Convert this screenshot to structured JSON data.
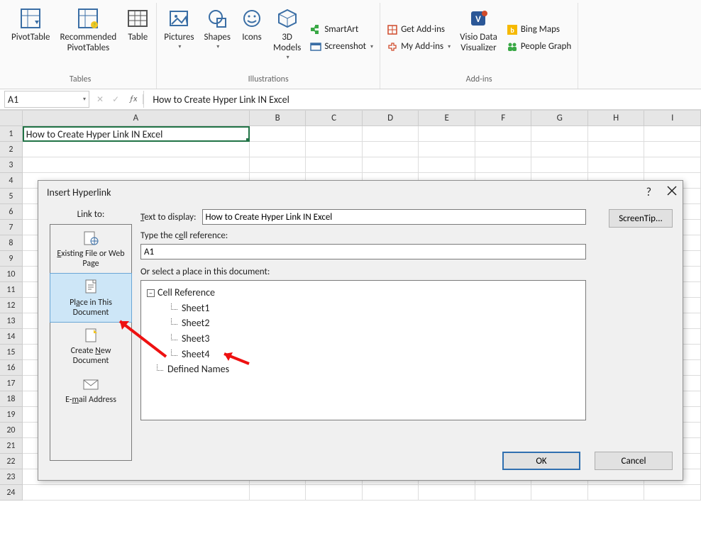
{
  "ribbon": {
    "groups": {
      "tables": {
        "label": "Tables",
        "pivottable": "PivotTable",
        "recommended": "Recommended\nPivotTables",
        "table": "Table"
      },
      "illustrations": {
        "label": "Illustrations",
        "pictures": "Pictures",
        "shapes": "Shapes",
        "icons": "Icons",
        "models": "3D\nModels",
        "smartart": "SmartArt",
        "screenshot": "Screenshot"
      },
      "addins": {
        "label": "Add-ins",
        "get": "Get Add-ins",
        "my": "My Add-ins",
        "visio": "Visio Data\nVisualizer",
        "bing": "Bing Maps",
        "people": "People Graph"
      }
    }
  },
  "formula_bar": {
    "name_box": "A1",
    "text": "How to Create Hyper Link IN Excel"
  },
  "grid": {
    "columns": [
      "A",
      "B",
      "C",
      "D",
      "E",
      "F",
      "G",
      "H",
      "I"
    ],
    "rows": [
      "1",
      "2",
      "3",
      "4",
      "5",
      "6",
      "7",
      "8",
      "9",
      "10",
      "11",
      "12",
      "13",
      "14",
      "15",
      "16",
      "17",
      "18",
      "19",
      "20",
      "21",
      "22",
      "23",
      "24"
    ],
    "a1": "How to Create Hyper Link IN Excel"
  },
  "dialog": {
    "title": "Insert Hyperlink",
    "help_icon": "?",
    "linkto_label": "Link to:",
    "linkto_items": {
      "existing": "Existing File or Web Page",
      "place": "Place in This Document",
      "create": "Create New Document",
      "email": "E-mail Address"
    },
    "text_to_display_label": "Text to display:",
    "text_to_display_value": "How to Create Hyper Link IN Excel",
    "screentip_btn": "ScreenTip...",
    "cellref_label": "Type the cell reference:",
    "cellref_value": "A1",
    "select_place_label": "Or select a place in this document:",
    "tree": {
      "cell_reference": "Cell Reference",
      "sheets": [
        "Sheet1",
        "Sheet2",
        "Sheet3",
        "Sheet4"
      ],
      "defined_names": "Defined Names"
    },
    "ok": "OK",
    "cancel": "Cancel"
  }
}
